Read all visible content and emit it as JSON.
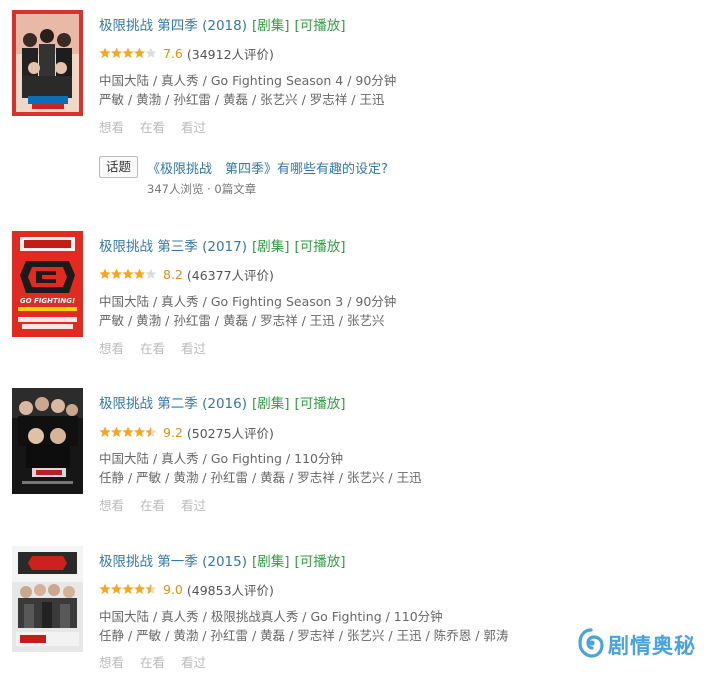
{
  "results": [
    {
      "title": "极限挑战 第四季 (2018)",
      "tags": [
        "[剧集]",
        "[可播放]"
      ],
      "stars": 4,
      "score": "7.6",
      "votes": "(34912人评价)",
      "meta": "中国大陆 / 真人秀 / Go Fighting Season 4 / 90分钟",
      "cast": "严敏 / 黄渤 / 孙红雷 / 黄磊 / 张艺兴 / 罗志祥 / 王迅",
      "actions": [
        "想看",
        "在看",
        "看过"
      ]
    },
    {
      "title": "极限挑战 第三季 (2017)",
      "tags": [
        "[剧集]",
        "[可播放]"
      ],
      "stars": 4,
      "score": "8.2",
      "votes": "(46377人评价)",
      "meta": "中国大陆 / 真人秀 / Go Fighting Season 3 / 90分钟",
      "cast": "严敏 / 黄渤 / 孙红雷 / 黄磊 / 罗志祥 / 王迅 / 张艺兴",
      "actions": [
        "想看",
        "在看",
        "看过"
      ]
    },
    {
      "title": "极限挑战 第二季 (2016)",
      "tags": [
        "[剧集]",
        "[可播放]"
      ],
      "stars": 4.5,
      "score": "9.2",
      "votes": "(50275人评价)",
      "meta": "中国大陆 / 真人秀 / Go Fighting / 110分钟",
      "cast": "任静 / 严敏 / 黄渤 / 孙红雷 / 黄磊 / 罗志祥 / 张艺兴 / 王迅",
      "actions": [
        "想看",
        "在看",
        "看过"
      ]
    },
    {
      "title": "极限挑战 第一季 (2015)",
      "tags": [
        "[剧集]",
        "[可播放]"
      ],
      "stars": 4.5,
      "score": "9.0",
      "votes": "(49853人评价)",
      "meta": "中国大陆 / 真人秀 / 极限挑战真人秀 / Go Fighting / 110分钟",
      "cast": "任静 / 严敏 / 黄渤 / 孙红雷 / 黄磊 / 罗志祥 / 张艺兴 / 王迅 / 陈乔恩 / 郭涛",
      "actions": [
        "想看",
        "在看",
        "看过"
      ]
    }
  ],
  "topic": {
    "badge": "话题",
    "question": "《极限挑战　第四季》有哪些有趣的设定?",
    "stats": "347人浏览 · 0篇文章"
  },
  "posters": {
    "p2_caption": "GO FIGHTING!"
  },
  "watermark": {
    "text": "剧情奥秘",
    "color": "#4aa3df"
  },
  "colors": {
    "link": "#3377aa",
    "green_tag": "#2f9e3f",
    "score": "#e09015",
    "star": "#f5a623",
    "star_empty": "#dddddd"
  }
}
